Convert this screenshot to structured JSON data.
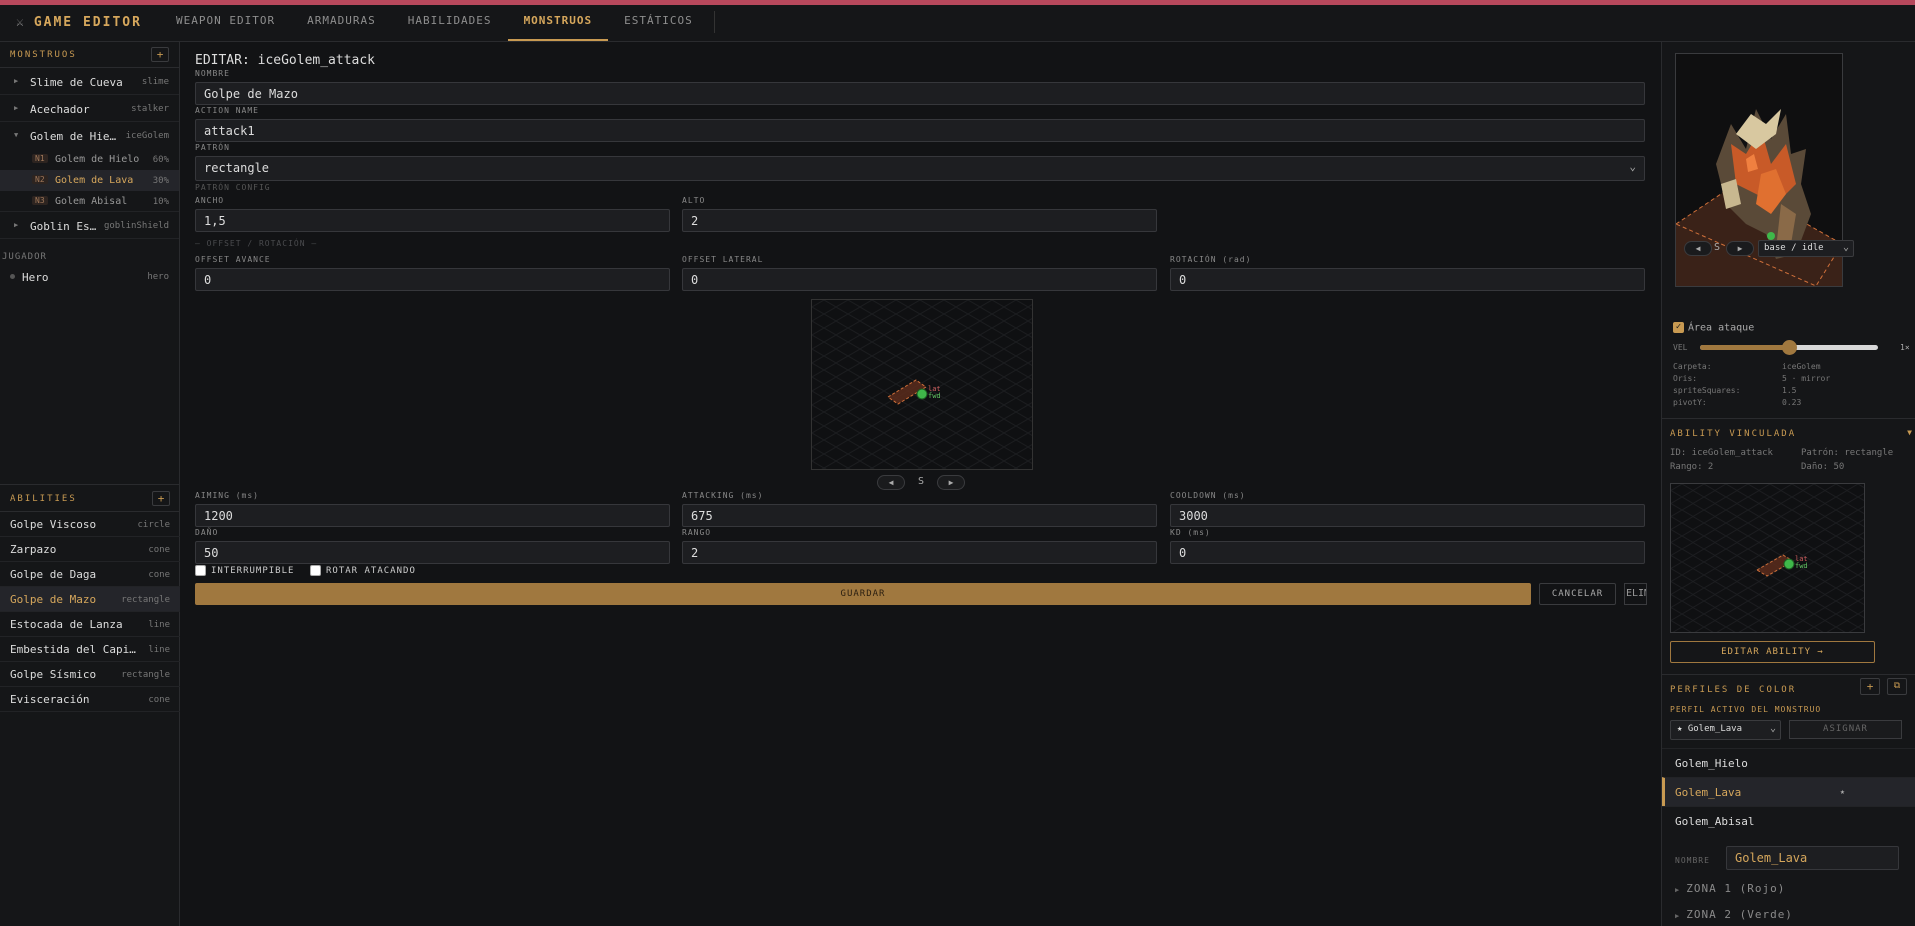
{
  "app": {
    "title": "GAME EDITOR",
    "icon": "swords-icon"
  },
  "nav": {
    "tabs": [
      {
        "label": "WEAPON EDITOR"
      },
      {
        "label": "ARMADURAS"
      },
      {
        "label": "HABILIDADES"
      },
      {
        "label": "MONSTRUOS"
      },
      {
        "label": "ESTÁTICOS"
      }
    ],
    "active": "MONSTRUOS"
  },
  "sidebar": {
    "monsters_title": "MONSTRUOS",
    "add": "+",
    "monsters": [
      {
        "name": "Slime de Cueva",
        "key": "slime"
      },
      {
        "name": "Acechador",
        "key": "stalker"
      },
      {
        "name": "Golem de Hie…",
        "key": "iceGolem"
      },
      {
        "name": "Goblin Es…",
        "key": "goblinShield"
      }
    ],
    "variants": [
      {
        "level": "N1",
        "name": "Golem de Hielo",
        "pct": "60%"
      },
      {
        "level": "N2",
        "name": "Golem de Lava",
        "pct": "30%"
      },
      {
        "level": "N3",
        "name": "Golem Abisal",
        "pct": "10%"
      }
    ],
    "player_title": "JUGADOR",
    "player": {
      "name": "Hero",
      "key": "hero"
    },
    "abilities_title": "ABILITIES",
    "abilities": [
      {
        "name": "Golpe Viscoso",
        "type": "circle"
      },
      {
        "name": "Zarpazo",
        "type": "cone"
      },
      {
        "name": "Golpe de Daga",
        "type": "cone"
      },
      {
        "name": "Golpe de Mazo",
        "type": "rectangle"
      },
      {
        "name": "Estocada de Lanza",
        "type": "line"
      },
      {
        "name": "Embestida del Capi…",
        "type": "line"
      },
      {
        "name": "Golpe Sísmico",
        "type": "rectangle"
      },
      {
        "name": "Evisceración",
        "type": "cone"
      }
    ]
  },
  "editor": {
    "title": "EDITAR: iceGolem_attack",
    "nombre_label": "NOMBRE",
    "nombre": "Golpe de Mazo",
    "action_label": "ACTION NAME",
    "action": "attack1",
    "patron_label": "PATRÓN",
    "patron": "rectangle",
    "patron_config_label": "PATRÓN CONFIG",
    "ancho_label": "ANCHO",
    "ancho": "1,5",
    "alto_label": "ALTO",
    "alto": "2",
    "offset_divider": "— OFFSET / ROTACIÓN —",
    "offset_avance_label": "OFFSET AVANCE",
    "offset_avance": "0",
    "offset_lateral_label": "OFFSET LATERAL",
    "offset_lateral": "0",
    "rotacion_label": "ROTACIÓN (rad)",
    "rotacion": "0",
    "preview_dir": "S",
    "prev": "◀",
    "next": "▶",
    "marker_lat": "lat",
    "marker_fwd": "fwd",
    "aiming_label": "AIMING (ms)",
    "aiming": "1200",
    "attacking_label": "ATTACKING (ms)",
    "attacking": "675",
    "cooldown_label": "COOLDOWN (ms)",
    "cooldown": "3000",
    "dano_label": "DAÑO",
    "dano": "50",
    "rango_label": "RANGO",
    "rango": "2",
    "kd_label": "KD (ms)",
    "kd": "0",
    "interrumpible": "INTERRUMPIBLE",
    "rotar": "ROTAR ATACANDO",
    "save": "GUARDAR",
    "cancel": "CANCELAR",
    "delete": "ELIMINAR"
  },
  "right": {
    "dir": "S",
    "prev": "◀",
    "next": "▶",
    "anim": "base / idle",
    "area_label": "Área ataque",
    "vel_label": "VEL",
    "vel_value": "1×",
    "vel_fraction": 0.5,
    "props": [
      {
        "k": "Carpeta:",
        "v": "iceGolem"
      },
      {
        "k": "Oris:",
        "v": "5 · mirror"
      },
      {
        "k": "spriteSquares:",
        "v": "1.5"
      },
      {
        "k": "pivotY:",
        "v": "0.23"
      }
    ],
    "ability_title": "ABILITY VINCULADA",
    "ability_id": "ID: iceGolem_attack",
    "ability_patron": "Patrón: rectangle",
    "ability_rango": "Rango: 2",
    "ability_dano": "Daño: 50",
    "edit_ability": "EDITAR ABILITY →",
    "profiles_title": "PERFILES DE COLOR",
    "active_label": "PERFIL ACTIVO DEL MONSTRUO",
    "active_profile": "★ Golem_Lava",
    "assign": "ASIGNAR",
    "profiles": [
      {
        "name": "Golem_Hielo"
      },
      {
        "name": "Golem_Lava",
        "star": "★"
      },
      {
        "name": "Golem_Abisal"
      }
    ],
    "nombre_label": "NOMBRE",
    "nombre": "Golem_Lava",
    "zonas": [
      "ZONA 1 (Rojo)",
      "ZONA 2 (Verde)"
    ]
  },
  "colors": {
    "accent": "#c89a52",
    "topbar": "#b8485c",
    "bg": "#121315"
  }
}
